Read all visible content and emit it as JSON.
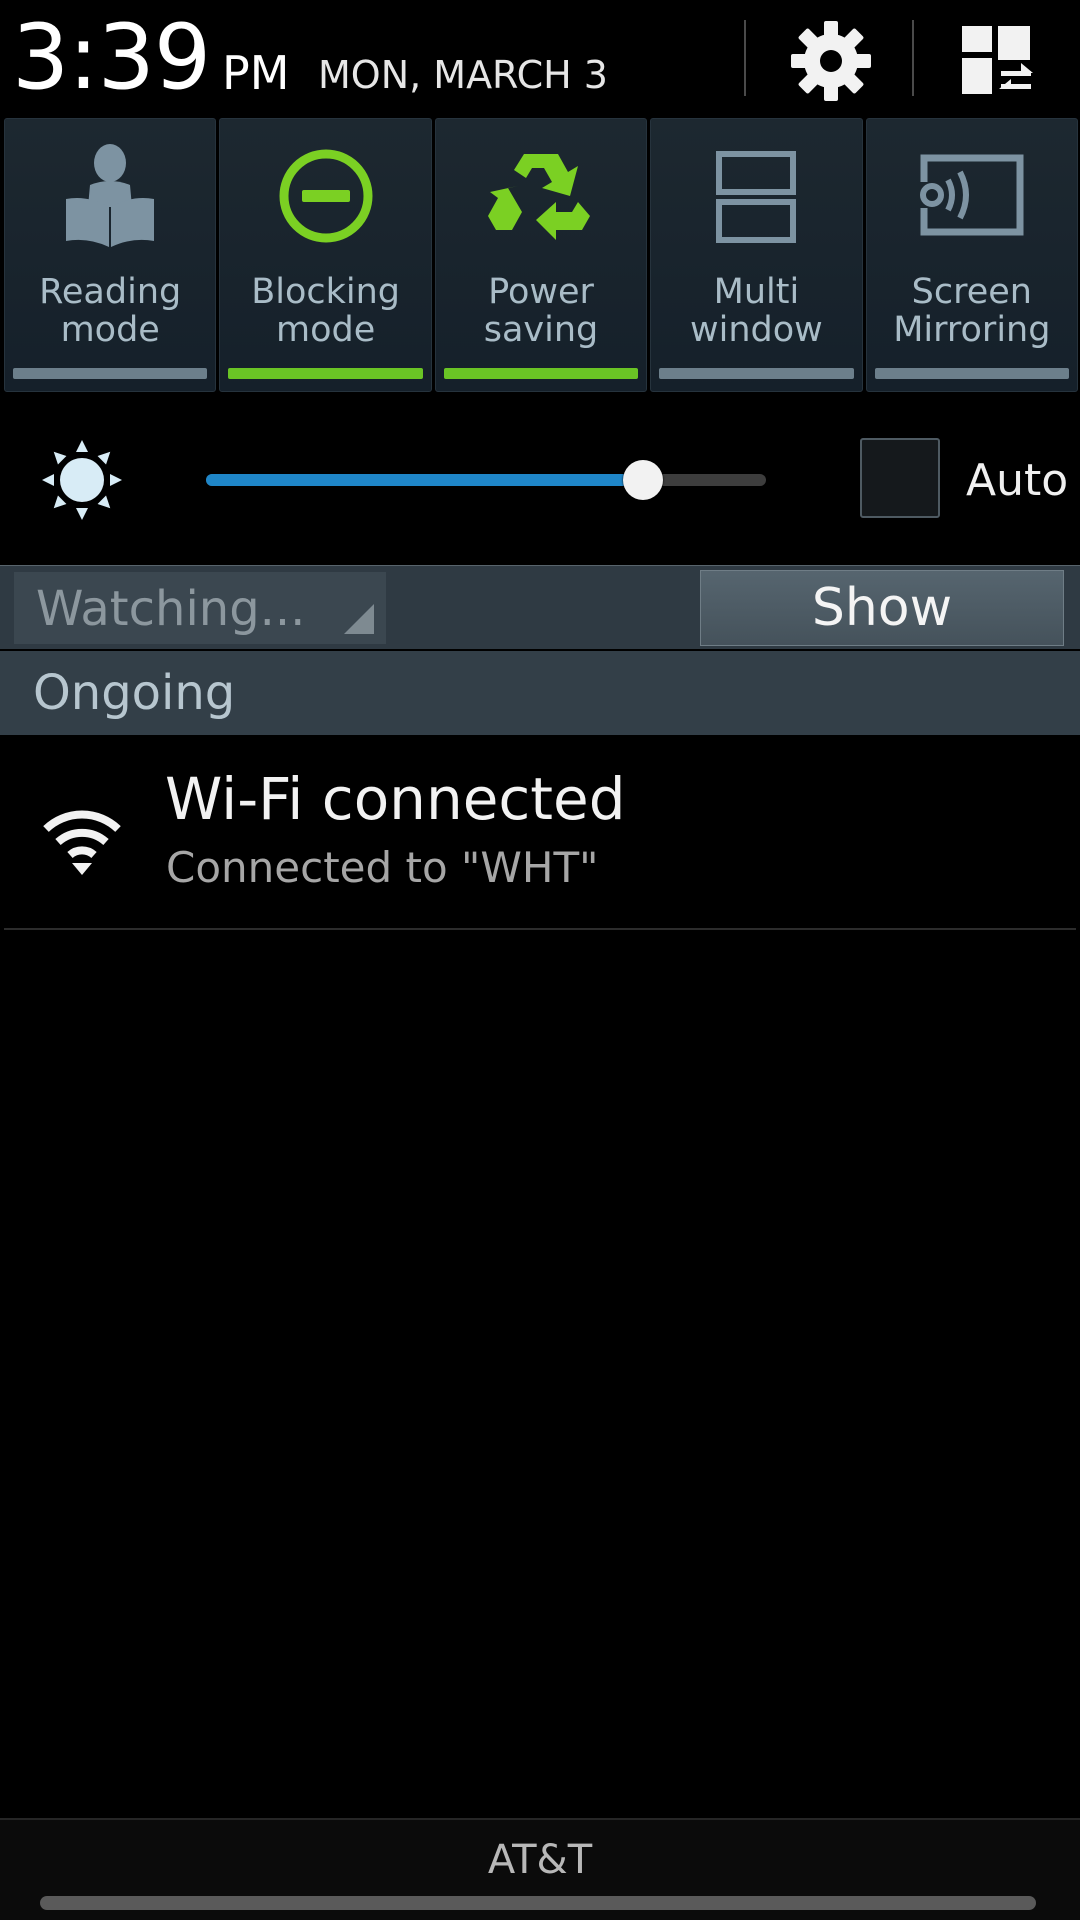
{
  "header": {
    "time": "3:39",
    "ampm": "PM",
    "date": "MON, MARCH 3",
    "settings_icon": "gear-icon",
    "edit_icon": "grid-edit-icon"
  },
  "toggles": [
    {
      "label": "Reading\nmode",
      "icon": "reading-person-icon",
      "on": false
    },
    {
      "label": "Blocking\nmode",
      "icon": "blocking-icon",
      "on": true
    },
    {
      "label": "Power\nsaving",
      "icon": "recycle-icon",
      "on": true
    },
    {
      "label": "Multi\nwindow",
      "icon": "multi-window-icon",
      "on": false
    },
    {
      "label": "Screen\nMirroring",
      "icon": "screen-mirroring-icon",
      "on": false
    }
  ],
  "brightness": {
    "icon": "sun-icon",
    "level": 0.78,
    "auto_label": "Auto",
    "auto_checked": false
  },
  "watch": {
    "selector_text": "Watching...",
    "show_label": "Show"
  },
  "ongoing": {
    "section_label": "Ongoing",
    "notifications": [
      {
        "icon": "wifi-icon",
        "title": "Wi-Fi connected",
        "subtitle": "Connected to \"WHT\""
      }
    ]
  },
  "carrier": "AT&T",
  "colors": {
    "toggle_on": "#6ac425",
    "toggle_off": "#6c7f8b",
    "slider_fill": "#1f86c8",
    "icon_green": "#7bd023",
    "icon_gray": "#7d93a2"
  }
}
